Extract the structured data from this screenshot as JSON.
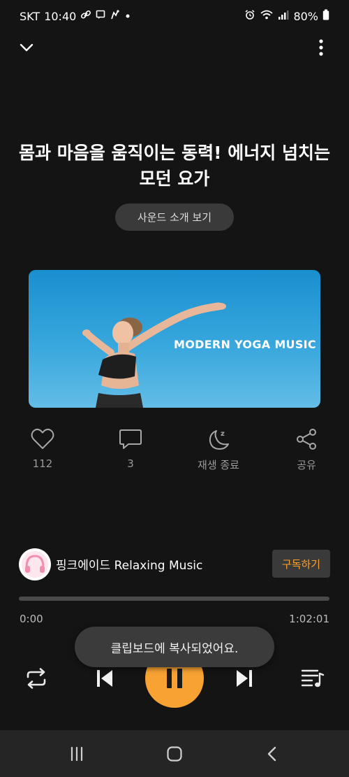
{
  "status_bar": {
    "carrier": "SKT",
    "time": "10:40",
    "battery": "80%",
    "left_icons": [
      "link-icon",
      "message-icon",
      "gesture-icon",
      "dot-icon"
    ],
    "right_icons": [
      "alarm-icon",
      "wifi-icon",
      "signal-icon",
      "battery-icon"
    ]
  },
  "top_bar": {
    "collapse_icon": "chevron-down-icon",
    "more_icon": "more-vertical-icon"
  },
  "track": {
    "title": "몸과 마음을 움직이는 동력! 에너지 넘치는 모던 요가",
    "intro_button": "사운드 소개 보기",
    "banner_text": "MODERN YOGA MUSIC"
  },
  "actions": [
    {
      "icon": "heart-icon",
      "label": "112"
    },
    {
      "icon": "comment-icon",
      "label": "3"
    },
    {
      "icon": "sleep-timer-icon",
      "label": "재생 종료"
    },
    {
      "icon": "share-icon",
      "label": "공유"
    }
  ],
  "channel": {
    "name": "핑크에이드 Relaxing Music",
    "subscribe_label": "구독하기"
  },
  "player": {
    "current_time": "0:00",
    "total_time": "1:02:01",
    "progress": 0,
    "state": "playing"
  },
  "toast": {
    "message": "클립보드에 복사되었어요."
  },
  "colors": {
    "background": "#141414",
    "accent": "#f7a233",
    "surface": "#3a3a3a"
  }
}
